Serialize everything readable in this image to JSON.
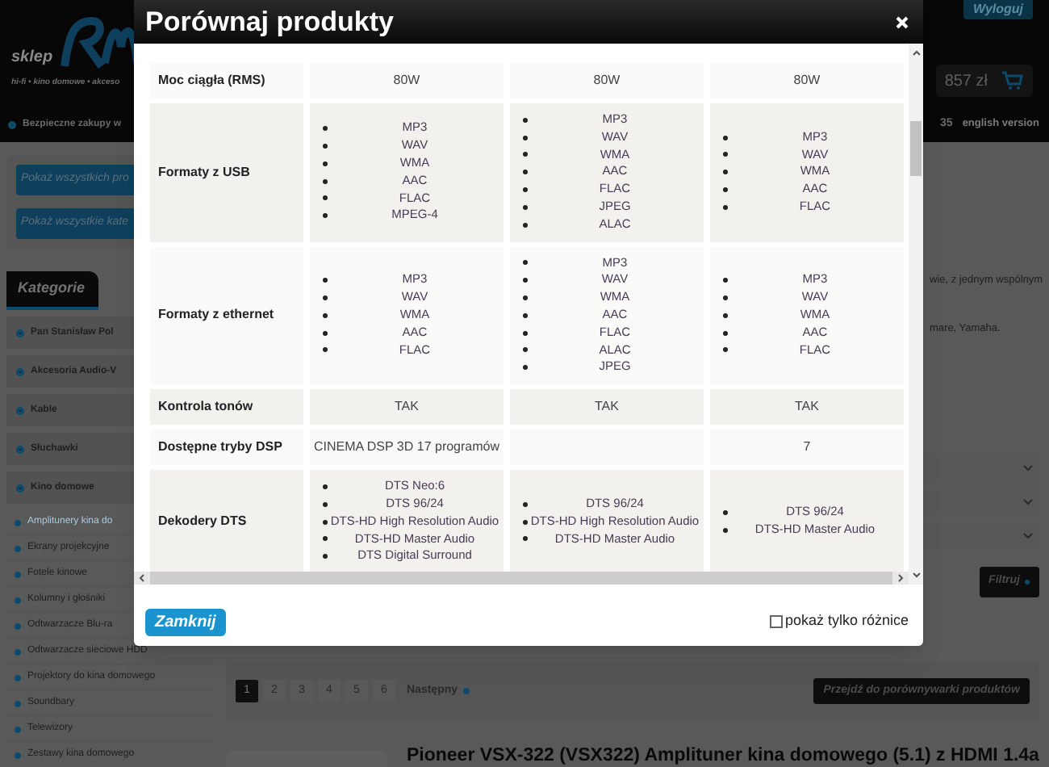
{
  "background_page": {
    "header": {
      "logo_text": "sklep",
      "tagline": "hi-fi • kino domowe • akceso",
      "logout_button": "Wyloguj",
      "cart_total": "857 zł",
      "notice": "Bezpieczne zakupy w",
      "phone_fragment": "35",
      "language_link": "english version"
    },
    "sidebar": {
      "buttons": [
        "Pokaż wszystkich pro",
        "Pokaż wszystkie kate"
      ],
      "categories_title": "Kategorie",
      "categories": [
        {
          "label": "Pan Stanisław Pol"
        },
        {
          "label": "Akcesoria Audio-V"
        },
        {
          "label": "Kable"
        },
        {
          "label": "Słuchawki"
        },
        {
          "label": "Kino domowe",
          "children": [
            {
              "label": "Amplitunery kina do",
              "selected": true
            },
            {
              "label": "Ekrany projekcyjne",
              "selected": false
            },
            {
              "label": "Fotele kinowe",
              "selected": false
            },
            {
              "label": "Kolumny i głośniki",
              "selected": false
            },
            {
              "label": "Odtwarzacze Blu-ra",
              "selected": false
            },
            {
              "label": "Odtwarzacze sieciowe HDD",
              "selected": false
            },
            {
              "label": "Projektory do kina domowego",
              "selected": false
            },
            {
              "label": "Soundbary",
              "selected": false
            },
            {
              "label": "Telewizory",
              "selected": false
            },
            {
              "label": "Zestawy kina domowego",
              "selected": false
            }
          ]
        }
      ]
    },
    "content": {
      "description_lines": [
        "wie, z jednym wspólnym",
        "mare, Yamaha."
      ],
      "filter_button": "Filtruj",
      "pagination": [
        {
          "label": "1",
          "selected": true
        },
        {
          "label": "2",
          "selected": false
        },
        {
          "label": "3",
          "selected": false
        },
        {
          "label": "4",
          "selected": false
        },
        {
          "label": "5",
          "selected": false
        },
        {
          "label": "6",
          "selected": false
        }
      ],
      "next_link": "Następny",
      "compare_link": "Przejdź do porównywarki produktów",
      "product_title": "Pioneer VSX-322 (VSX322) Amplituner kina domowego (5.1) z HDMI 1.4a"
    }
  },
  "modal": {
    "title": "Porównaj produkty",
    "rows": [
      {
        "label": "Moc ciągła (RMS)",
        "cells": [
          {
            "kind": "text",
            "text": "80W"
          },
          {
            "kind": "text",
            "text": "80W"
          },
          {
            "kind": "text",
            "text": "80W"
          }
        ]
      },
      {
        "label": "Formaty z USB",
        "cells": [
          {
            "kind": "list",
            "items": [
              "MP3",
              "WAV",
              "WMA",
              "AAC",
              "FLAC",
              "MPEG-4"
            ]
          },
          {
            "kind": "list",
            "items": [
              "MP3",
              "WAV",
              "WMA",
              "AAC",
              "FLAC",
              "JPEG",
              "ALAC"
            ]
          },
          {
            "kind": "list",
            "items": [
              "MP3",
              "WAV",
              "WMA",
              "AAC",
              "FLAC"
            ]
          }
        ]
      },
      {
        "label": "Formaty z ethernet",
        "cells": [
          {
            "kind": "list",
            "items": [
              "MP3",
              "WAV",
              "WMA",
              "AAC",
              "FLAC"
            ]
          },
          {
            "kind": "list",
            "items": [
              "MP3",
              "WAV",
              "WMA",
              "AAC",
              "FLAC",
              "ALAC",
              "JPEG"
            ]
          },
          {
            "kind": "list",
            "items": [
              "MP3",
              "WAV",
              "WMA",
              "AAC",
              "FLAC"
            ]
          }
        ]
      },
      {
        "label": "Kontrola tonów",
        "cells": [
          {
            "kind": "text",
            "text": "TAK"
          },
          {
            "kind": "text",
            "text": "TAK"
          },
          {
            "kind": "text",
            "text": "TAK"
          }
        ]
      },
      {
        "label": "Dostępne tryby DSP",
        "cells": [
          {
            "kind": "text",
            "text": "CINEMA DSP 3D 17 programów"
          },
          {
            "kind": "blank"
          },
          {
            "kind": "text",
            "text": "7"
          }
        ]
      },
      {
        "label": "Dekodery DTS",
        "cells": [
          {
            "kind": "list",
            "items": [
              "DTS Neo:6",
              "DTS 96/24",
              "DTS-HD High Resolution Audio",
              "DTS-HD Master Audio",
              "DTS Digital Surround"
            ]
          },
          {
            "kind": "list",
            "items": [
              "DTS 96/24",
              "DTS-HD High Resolution Audio",
              "DTS-HD Master Audio"
            ]
          },
          {
            "kind": "list",
            "items": [
              "DTS 96/24",
              "DTS-HD Master Audio"
            ]
          }
        ]
      }
    ],
    "close_button": "Zamknij",
    "differences_only": {
      "label": "pokaż tylko różnice",
      "checked": false
    }
  }
}
